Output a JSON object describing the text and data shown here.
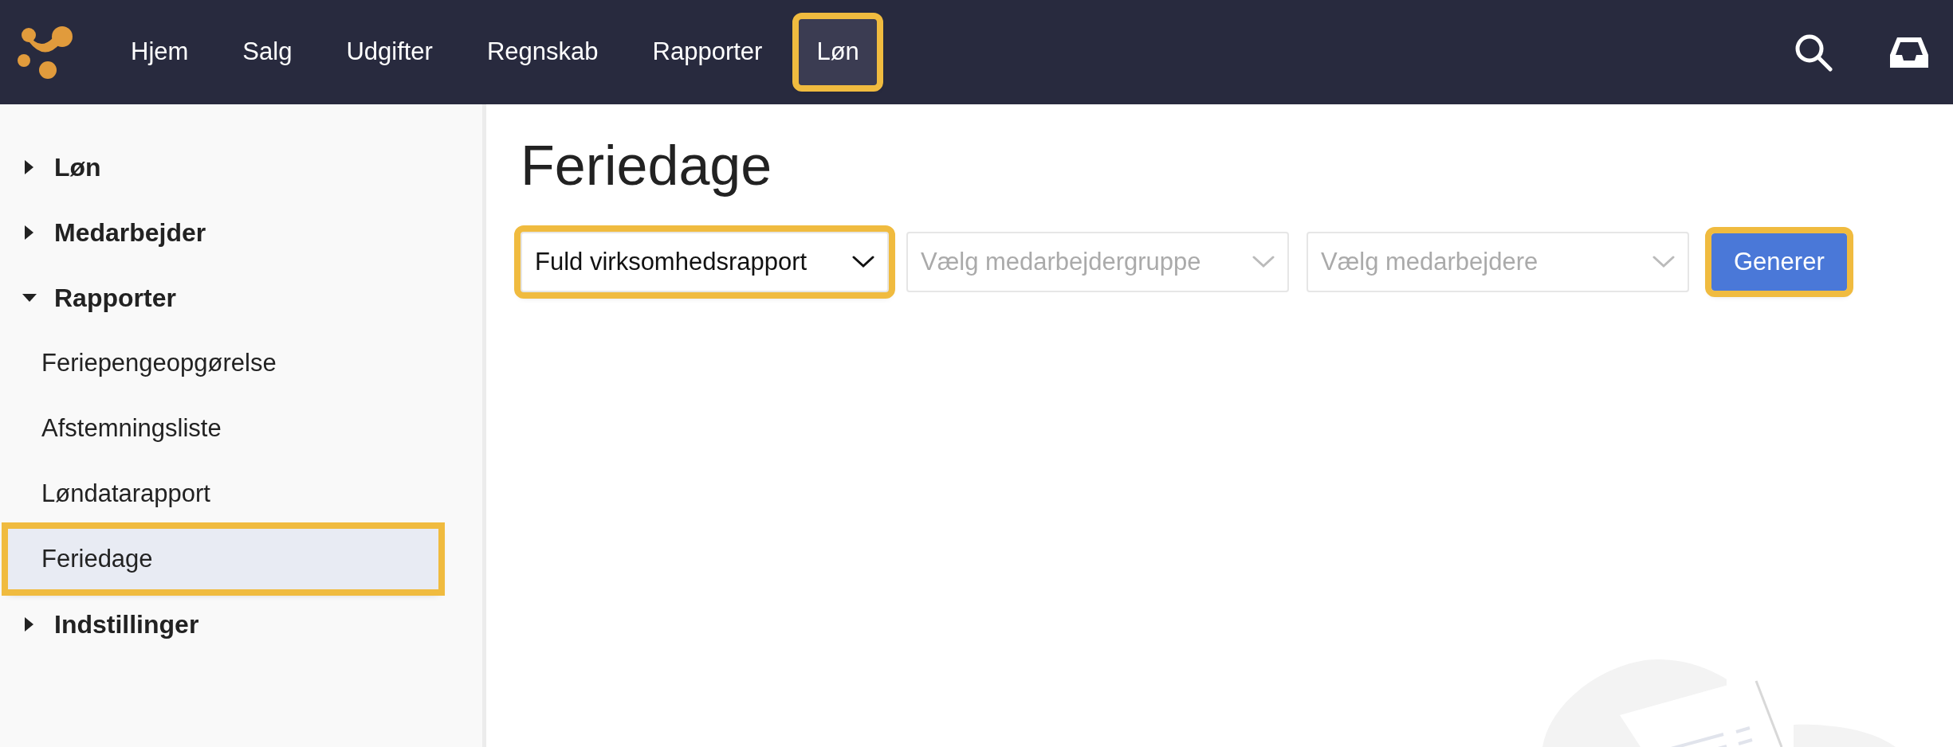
{
  "nav": {
    "items": [
      {
        "label": "Hjem",
        "selected": false,
        "highlighted": false
      },
      {
        "label": "Salg",
        "selected": false,
        "highlighted": false
      },
      {
        "label": "Udgifter",
        "selected": false,
        "highlighted": false
      },
      {
        "label": "Regnskab",
        "selected": false,
        "highlighted": false
      },
      {
        "label": "Rapporter",
        "selected": false,
        "highlighted": false
      },
      {
        "label": "Løn",
        "selected": true,
        "highlighted": true
      }
    ]
  },
  "sidebar": {
    "items": [
      {
        "label": "Løn",
        "expanded": false
      },
      {
        "label": "Medarbejder",
        "expanded": false
      },
      {
        "label": "Rapporter",
        "expanded": true,
        "children": [
          {
            "label": "Feriepengeopgørelse",
            "selected": false,
            "highlighted": false
          },
          {
            "label": "Afstemningsliste",
            "selected": false,
            "highlighted": false
          },
          {
            "label": "Løndatarapport",
            "selected": false,
            "highlighted": false
          },
          {
            "label": "Feriedage",
            "selected": true,
            "highlighted": true
          }
        ]
      },
      {
        "label": "Indstillinger",
        "expanded": false
      }
    ]
  },
  "page": {
    "title": "Feriedage",
    "filters": [
      {
        "value": "Fuld virksomhedsrapport",
        "highlighted": true
      },
      {
        "placeholder": "Vælg medarbejdergruppe",
        "highlighted": false
      },
      {
        "placeholder": "Vælg medarbejdere",
        "highlighted": false
      }
    ],
    "button": {
      "label": "Generer",
      "highlighted": true
    }
  }
}
